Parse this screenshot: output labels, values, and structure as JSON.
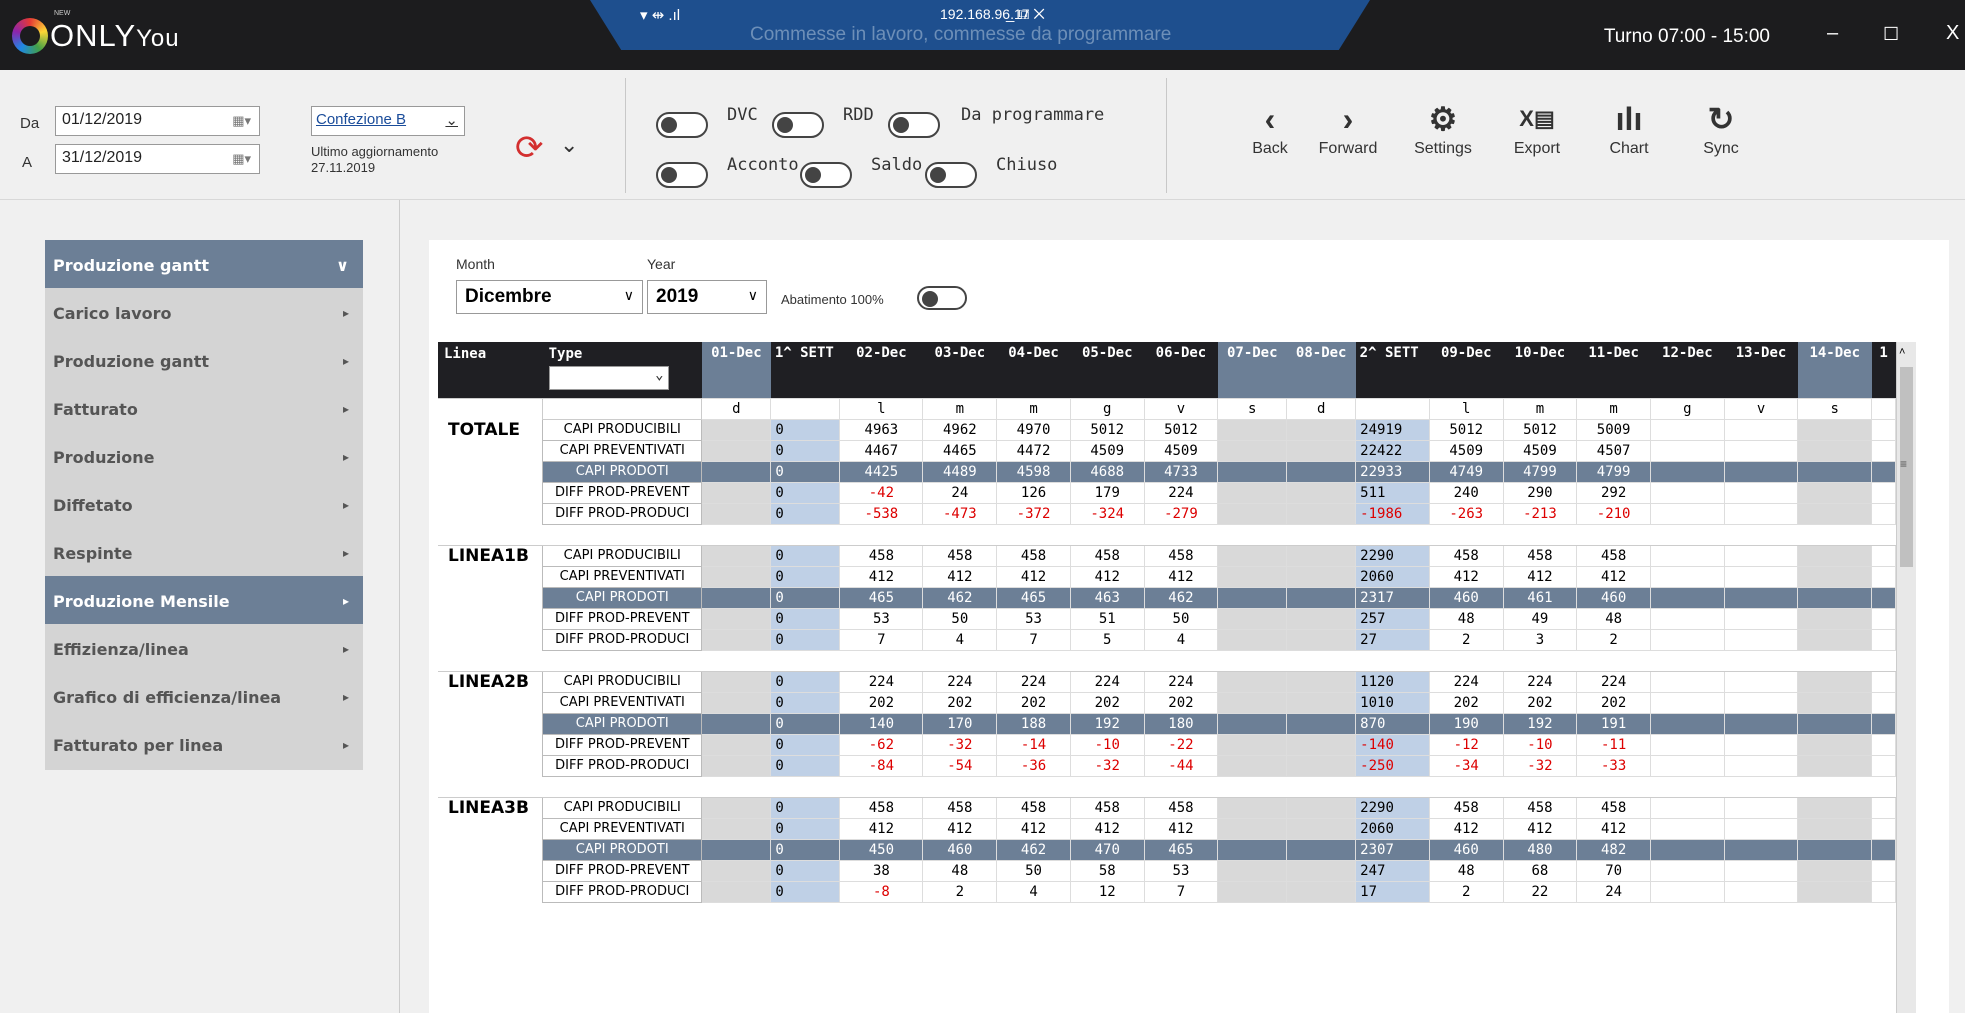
{
  "app": {
    "logo": "ONLY",
    "logo_you": "You",
    "logo_new": "NEW",
    "shift": "Turno 07:00 - 15:00",
    "min": "–",
    "max": "☐",
    "close": "X"
  },
  "remote": {
    "ip": "192.168.96.17",
    "title": "Commesse in lavoro, commesse da programmare"
  },
  "filters": {
    "from_label": "Da",
    "from_value": "01/12/2019",
    "to_label": "A",
    "to_value": "31/12/2019",
    "dept": "Confezione B",
    "last_update_label": "Ultimo aggiornamento",
    "last_update_date": "27.11.2019"
  },
  "toggles": [
    "DVC",
    "RDD",
    "Da programmare",
    "Acconto",
    "Saldo",
    "Chiuso"
  ],
  "nav": {
    "back": "Back",
    "forward": "Forward",
    "settings": "Settings",
    "export": "Export",
    "chart": "Chart",
    "sync": "Sync"
  },
  "sidebar": [
    {
      "label": "Produzione gantt",
      "active": true,
      "chevron": "∨"
    },
    {
      "label": "Carico lavoro"
    },
    {
      "label": "Produzione gantt"
    },
    {
      "label": "Fatturato"
    },
    {
      "label": "Produzione"
    },
    {
      "label": "Diffetato"
    },
    {
      "label": "Respinte"
    },
    {
      "label": "Produzione Mensile",
      "active": true
    },
    {
      "label": "Effizienza/linea"
    },
    {
      "label": "Grafico di efficienza/linea"
    },
    {
      "label": "Fatturato per linea"
    }
  ],
  "period": {
    "month_label": "Month",
    "month": "Dicembre",
    "year_label": "Year",
    "year": "2019",
    "abatimento": "Abatimento 100%"
  },
  "grid": {
    "col_linea": "Linea",
    "col_type": "Type",
    "days": [
      "01-Dec",
      "1^ SETT",
      "02-Dec",
      "03-Dec",
      "04-Dec",
      "05-Dec",
      "06-Dec",
      "07-Dec",
      "08-Dec",
      "2^ SETT",
      "09-Dec",
      "10-Dec",
      "11-Dec",
      "12-Dec",
      "13-Dec",
      "14-Dec",
      "1"
    ],
    "weekdays": [
      "d",
      "",
      "l",
      "m",
      "m",
      "g",
      "v",
      "s",
      "d",
      "",
      "l",
      "m",
      "m",
      "g",
      "v",
      "s",
      ""
    ],
    "groups": [
      {
        "name": "TOTALE",
        "rows": [
          {
            "type": "CAPI PRODUCIBILI",
            "v": [
              "",
              "0",
              "4963",
              "4962",
              "4970",
              "5012",
              "5012",
              "",
              "",
              "24919",
              "5012",
              "5012",
              "5009",
              "",
              "",
              "",
              ""
            ]
          },
          {
            "type": "CAPI PREVENTIVATI",
            "v": [
              "",
              "0",
              "4467",
              "4465",
              "4472",
              "4509",
              "4509",
              "",
              "",
              "22422",
              "4509",
              "4509",
              "4507",
              "",
              "",
              "",
              ""
            ]
          },
          {
            "type": "CAPI PRODOTI",
            "v": [
              "",
              "0",
              "4425",
              "4489",
              "4598",
              "4688",
              "4733",
              "",
              "",
              "22933",
              "4749",
              "4799",
              "4799",
              "",
              "",
              "",
              ""
            ]
          },
          {
            "type": "DIFF PROD-PREVENT",
            "v": [
              "",
              "0",
              "-42",
              "24",
              "126",
              "179",
              "224",
              "",
              "",
              "511",
              "240",
              "290",
              "292",
              "",
              "",
              "",
              ""
            ]
          },
          {
            "type": "DIFF PROD-PRODUCI",
            "v": [
              "",
              "0",
              "-538",
              "-473",
              "-372",
              "-324",
              "-279",
              "",
              "",
              "-1986",
              "-263",
              "-213",
              "-210",
              "",
              "",
              "",
              ""
            ]
          }
        ]
      },
      {
        "name": "LINEA1B",
        "rows": [
          {
            "type": "CAPI PRODUCIBILI",
            "v": [
              "",
              "0",
              "458",
              "458",
              "458",
              "458",
              "458",
              "",
              "",
              "2290",
              "458",
              "458",
              "458",
              "",
              "",
              "",
              ""
            ]
          },
          {
            "type": "CAPI PREVENTIVATI",
            "v": [
              "",
              "0",
              "412",
              "412",
              "412",
              "412",
              "412",
              "",
              "",
              "2060",
              "412",
              "412",
              "412",
              "",
              "",
              "",
              ""
            ]
          },
          {
            "type": "CAPI PRODOTI",
            "v": [
              "",
              "0",
              "465",
              "462",
              "465",
              "463",
              "462",
              "",
              "",
              "2317",
              "460",
              "461",
              "460",
              "",
              "",
              "",
              ""
            ]
          },
          {
            "type": "DIFF PROD-PREVENT",
            "v": [
              "",
              "0",
              "53",
              "50",
              "53",
              "51",
              "50",
              "",
              "",
              "257",
              "48",
              "49",
              "48",
              "",
              "",
              "",
              ""
            ]
          },
          {
            "type": "DIFF PROD-PRODUCI",
            "v": [
              "",
              "0",
              "7",
              "4",
              "7",
              "5",
              "4",
              "",
              "",
              "27",
              "2",
              "3",
              "2",
              "",
              "",
              "",
              ""
            ]
          }
        ]
      },
      {
        "name": "LINEA2B",
        "rows": [
          {
            "type": "CAPI PRODUCIBILI",
            "v": [
              "",
              "0",
              "224",
              "224",
              "224",
              "224",
              "224",
              "",
              "",
              "1120",
              "224",
              "224",
              "224",
              "",
              "",
              "",
              ""
            ]
          },
          {
            "type": "CAPI PREVENTIVATI",
            "v": [
              "",
              "0",
              "202",
              "202",
              "202",
              "202",
              "202",
              "",
              "",
              "1010",
              "202",
              "202",
              "202",
              "",
              "",
              "",
              ""
            ]
          },
          {
            "type": "CAPI PRODOTI",
            "v": [
              "",
              "0",
              "140",
              "170",
              "188",
              "192",
              "180",
              "",
              "",
              "870",
              "190",
              "192",
              "191",
              "",
              "",
              "",
              ""
            ]
          },
          {
            "type": "DIFF PROD-PREVENT",
            "v": [
              "",
              "0",
              "-62",
              "-32",
              "-14",
              "-10",
              "-22",
              "",
              "",
              "-140",
              "-12",
              "-10",
              "-11",
              "",
              "",
              "",
              ""
            ]
          },
          {
            "type": "DIFF PROD-PRODUCI",
            "v": [
              "",
              "0",
              "-84",
              "-54",
              "-36",
              "-32",
              "-44",
              "",
              "",
              "-250",
              "-34",
              "-32",
              "-33",
              "",
              "",
              "",
              ""
            ]
          }
        ]
      },
      {
        "name": "LINEA3B",
        "rows": [
          {
            "type": "CAPI PRODUCIBILI",
            "v": [
              "",
              "0",
              "458",
              "458",
              "458",
              "458",
              "458",
              "",
              "",
              "2290",
              "458",
              "458",
              "458",
              "",
              "",
              "",
              ""
            ]
          },
          {
            "type": "CAPI PREVENTIVATI",
            "v": [
              "",
              "0",
              "412",
              "412",
              "412",
              "412",
              "412",
              "",
              "",
              "2060",
              "412",
              "412",
              "412",
              "",
              "",
              "",
              ""
            ]
          },
          {
            "type": "CAPI PRODOTI",
            "v": [
              "",
              "0",
              "450",
              "460",
              "462",
              "470",
              "465",
              "",
              "",
              "2307",
              "460",
              "480",
              "482",
              "",
              "",
              "",
              ""
            ]
          },
          {
            "type": "DIFF PROD-PREVENT",
            "v": [
              "",
              "0",
              "38",
              "48",
              "50",
              "58",
              "53",
              "",
              "",
              "247",
              "48",
              "68",
              "70",
              "",
              "",
              "",
              ""
            ]
          },
          {
            "type": "DIFF PROD-PRODUCI",
            "v": [
              "",
              "0",
              "-8",
              "2",
              "4",
              "12",
              "7",
              "",
              "",
              "17",
              "2",
              "22",
              "24",
              "",
              "",
              "",
              ""
            ]
          }
        ]
      }
    ]
  }
}
